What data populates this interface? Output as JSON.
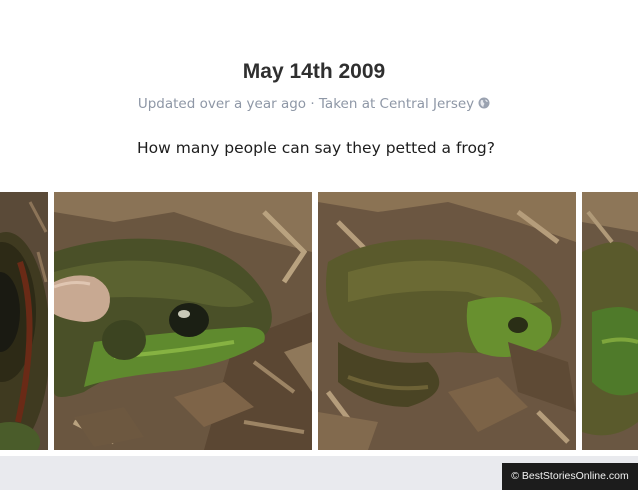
{
  "post": {
    "title": "May 14th 2009",
    "meta": "Updated over a year ago · Taken at Central Jersey",
    "meta_icon": "globe-icon",
    "caption": "How many people can say they petted a frog?"
  },
  "photos": [
    {
      "name": "frog-photo-1-partial"
    },
    {
      "name": "frog-photo-2"
    },
    {
      "name": "frog-photo-3"
    },
    {
      "name": "frog-photo-4-partial"
    }
  ],
  "watermark": {
    "text": "© BestStoriesOnline.com"
  },
  "colors": {
    "title": "#2f2f2f",
    "meta": "#8e97a6",
    "footer_bg": "#e9eaee",
    "watermark_bg": "#1c1c1c"
  }
}
